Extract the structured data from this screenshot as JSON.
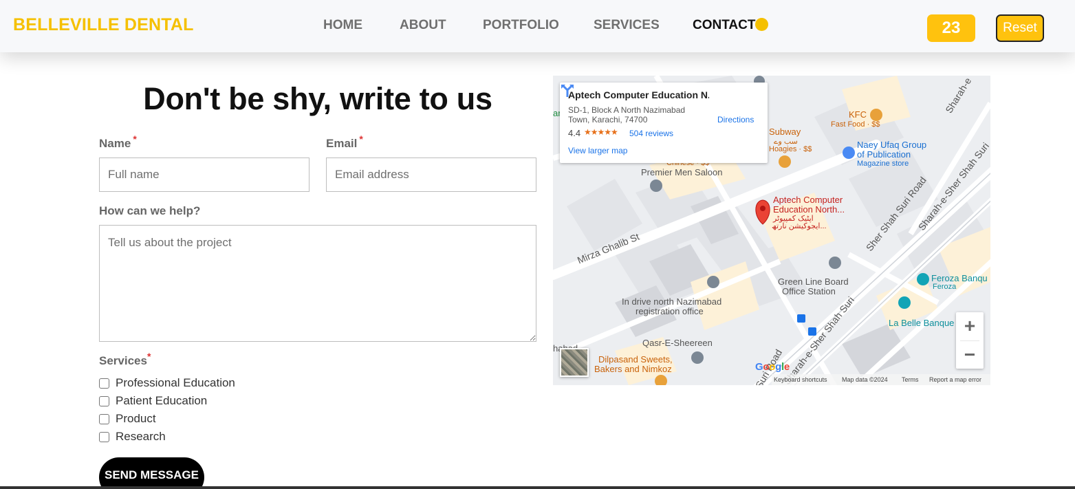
{
  "header": {
    "brand": "BELLEVILLE DENTAL",
    "nav": [
      "HOME",
      "ABOUT",
      "PORTFOLIO",
      "SERVICES",
      "CONTACT"
    ],
    "active_nav": "CONTACT",
    "counter": "23",
    "reset_label": "Reset"
  },
  "form": {
    "title": "Don't be shy, write to us",
    "name_label": "Name",
    "name_placeholder": "Full name",
    "email_label": "Email",
    "email_placeholder": "Email address",
    "required_mark": "*",
    "help_label": "How can we help?",
    "help_placeholder": "Tell us about the project",
    "services_label": "Services",
    "services": [
      "Professional Education",
      "Patient Education",
      "Product",
      "Research"
    ],
    "submit_label": "SEND MESSAGE"
  },
  "map": {
    "place_name": "Aptech Computer Education N...",
    "address": "SD-1, Block A North Nazimabad Town, Karachi, 74700",
    "rating": "4.4",
    "stars": "★★★★★",
    "reviews": "504 reviews",
    "directions_label": "Directions",
    "view_larger": "View larger map",
    "pin_label_line1": "Aptech Computer",
    "pin_label_line2": "Education North...",
    "pin_label_urdu1": "اپٹیک کمپیوٹر",
    "pin_label_urdu2": "ایجوکیشن نارتھ...",
    "labels": {
      "kfc": "KFC",
      "kfc_sub": "Fast Food · $$",
      "subway": "Subway",
      "subway_urdu": "سب وے",
      "subway_sub": "Hoagies · $$",
      "naey_ufaq_1": "Naey Ufaq Group",
      "naey_ufaq_2": "of Publication",
      "naey_ufaq_sub": "Magazine store",
      "premier": "Premier Men Saloon",
      "chinese": "Chinese · $$",
      "mirza": "Mirza Ghalib St",
      "sher_shah_road": "Sher Shah Suri Road",
      "sharah_1": "Sharah-e-Sher Shah Suri",
      "sharah_2": "Sharah-e-Sher Shah Suri",
      "sharah_3": "Sharah-e",
      "green_line_1": "Green Line Board",
      "green_line_2": "Office Station",
      "indrive_1": "In drive north Nazimabad",
      "indrive_2": "registration office",
      "feroza_1": "Feroza Banqu",
      "feroza_2": "Feroza",
      "la_belle": "La Belle Banque",
      "qasr": "Qasr-E-Sheereen",
      "dilpasand_1": "Dilpasand Sweets,",
      "dilpasand_2": "Bakers and Nimkoz",
      "suri_road": "Suri Road",
      "edge_tl": "ar",
      "edge_bl": "hahad"
    },
    "zoom_in": "+",
    "zoom_out": "−",
    "google": "Google",
    "keyboard_shortcuts": "Keyboard shortcuts",
    "map_data": "Map data ©2024",
    "terms": "Terms",
    "report": "Report a map error"
  },
  "colors": {
    "brand": "#f5c000",
    "accent": "#ffc20e",
    "button_dark": "#000000",
    "required": "#dd3333",
    "map_link": "#1a73e8",
    "map_pin": "#ea4335"
  }
}
